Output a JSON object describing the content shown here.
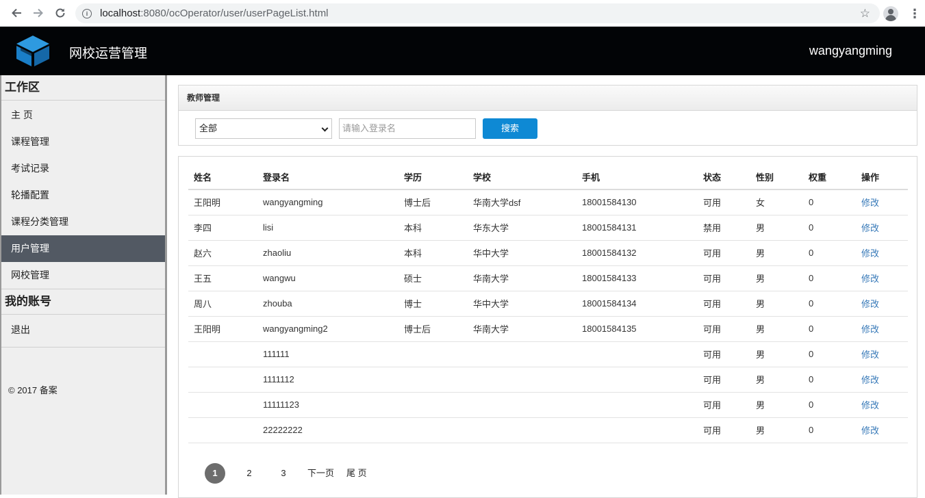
{
  "browser": {
    "url_host": "localhost",
    "url_rest": ":8080/ocOperator/user/userPageList.html"
  },
  "header": {
    "title": "网校运营管理",
    "user": "wangyangming"
  },
  "sidebar": {
    "section_work": "工作区",
    "items": [
      {
        "label": "主 页"
      },
      {
        "label": "课程管理"
      },
      {
        "label": "考试记录"
      },
      {
        "label": "轮播配置"
      },
      {
        "label": "课程分类管理"
      },
      {
        "label": "用户管理",
        "active": true
      },
      {
        "label": "网校管理"
      }
    ],
    "section_account": "我的账号",
    "logout": "退出",
    "copyright": "© 2017  备案"
  },
  "filter": {
    "panel_title": "教师管理",
    "select_value": "全部",
    "search_placeholder": "请输入登录名",
    "search_button": "搜索"
  },
  "table": {
    "columns": [
      "姓名",
      "登录名",
      "学历",
      "学校",
      "手机",
      "状态",
      "性别",
      "权重",
      "操作"
    ],
    "rows": [
      [
        "王阳明",
        "wangyangming",
        "博士后",
        "华南大学dsf",
        "18001584130",
        "可用",
        "女",
        "0",
        "修改"
      ],
      [
        "李四",
        "lisi",
        "本科",
        "华东大学",
        "18001584131",
        "禁用",
        "男",
        "0",
        "修改"
      ],
      [
        "赵六",
        "zhaoliu",
        "本科",
        "华中大学",
        "18001584132",
        "可用",
        "男",
        "0",
        "修改"
      ],
      [
        "王五",
        "wangwu",
        "硕士",
        "华南大学",
        "18001584133",
        "可用",
        "男",
        "0",
        "修改"
      ],
      [
        "周八",
        "zhouba",
        "博士",
        "华中大学",
        "18001584134",
        "可用",
        "男",
        "0",
        "修改"
      ],
      [
        "王阳明",
        "wangyangming2",
        "博士后",
        "华南大学",
        "18001584135",
        "可用",
        "男",
        "0",
        "修改"
      ],
      [
        "",
        "111111",
        "",
        "",
        "",
        "可用",
        "男",
        "0",
        "修改"
      ],
      [
        "",
        "1111112",
        "",
        "",
        "",
        "可用",
        "男",
        "0",
        "修改"
      ],
      [
        "",
        "11111123",
        "",
        "",
        "",
        "可用",
        "男",
        "0",
        "修改"
      ],
      [
        "",
        "22222222",
        "",
        "",
        "",
        "可用",
        "男",
        "0",
        "修改"
      ]
    ]
  },
  "pager": {
    "pages": [
      "1",
      "2",
      "3"
    ],
    "current": "1",
    "next": "下一页",
    "last": "尾 页"
  },
  "colors": {
    "header_bg": "#020406",
    "active_item": "#525963",
    "search_button": "#0e89d4",
    "link": "#3779b8"
  }
}
